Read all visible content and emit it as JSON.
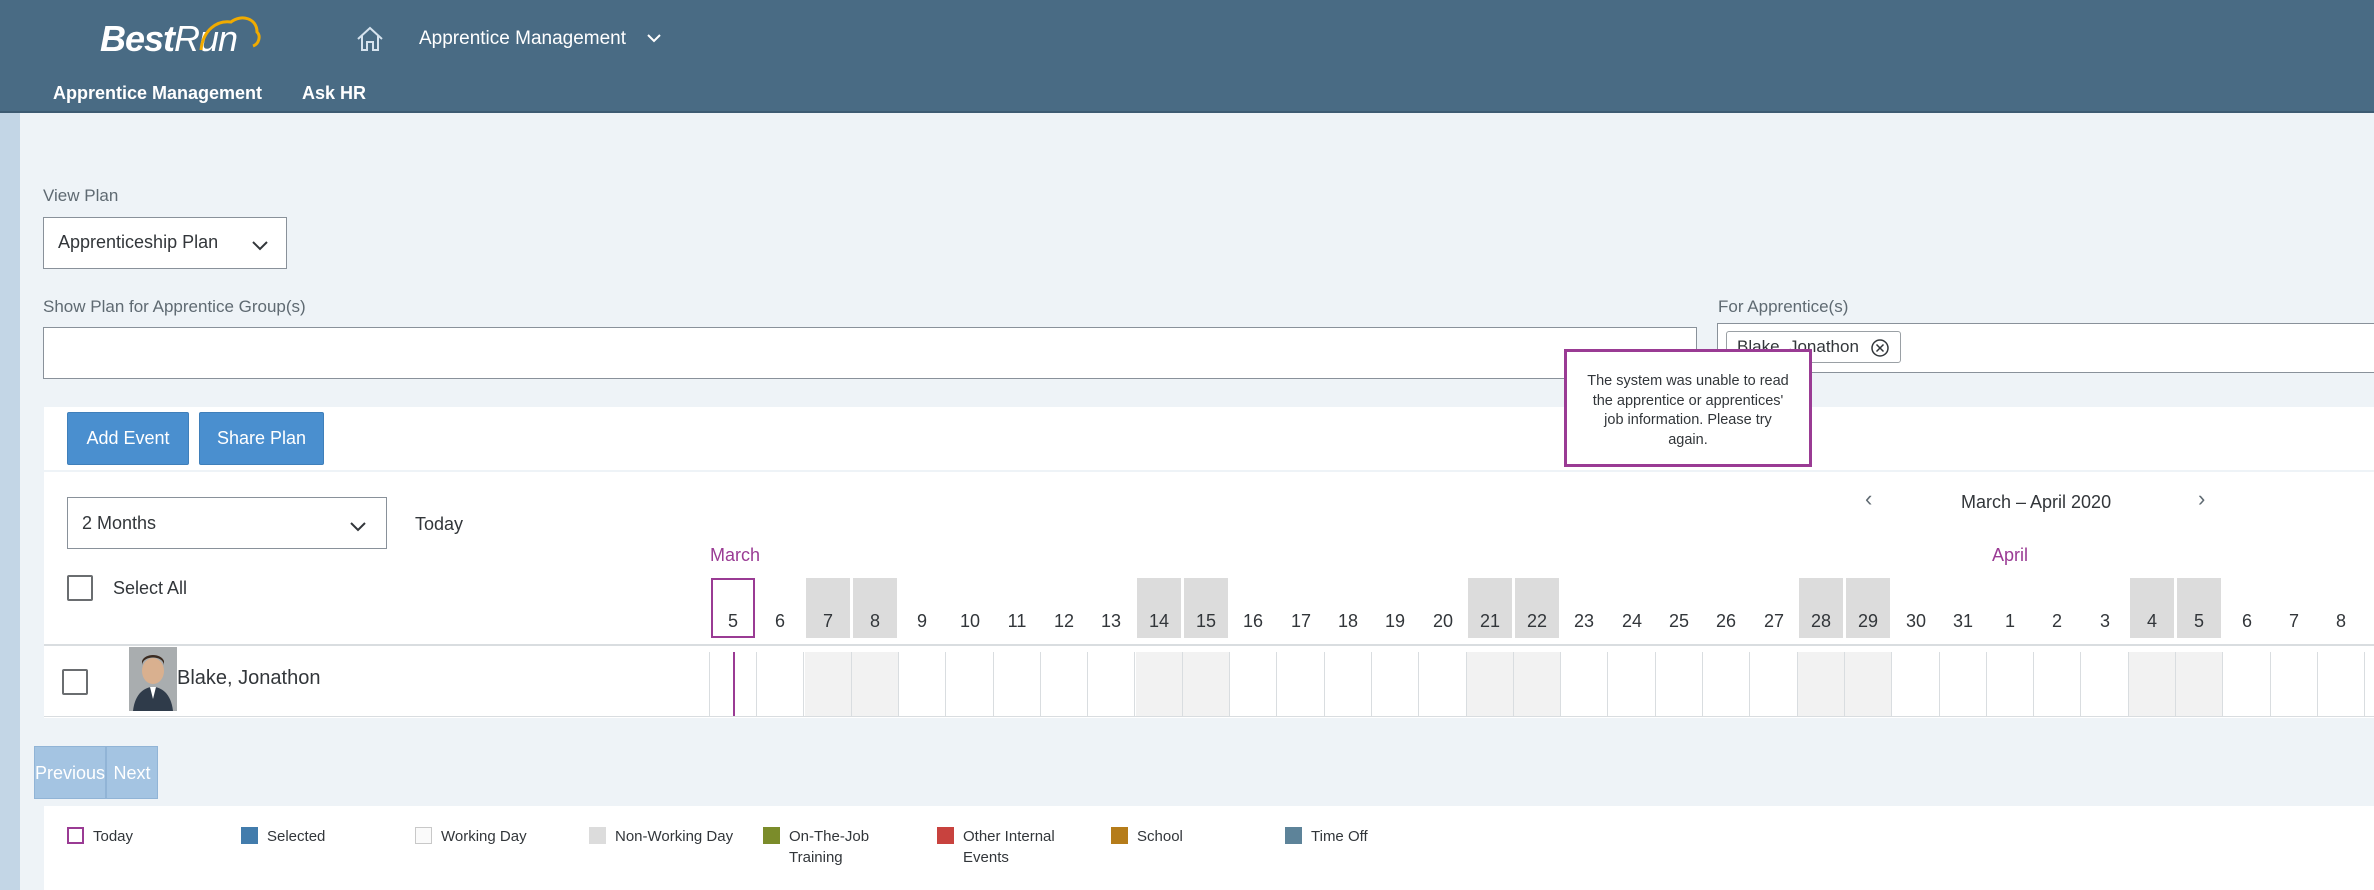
{
  "header": {
    "logo_bold": "Best",
    "logo_light": "Run",
    "app_title": "Apprentice Management",
    "nav": [
      "Apprentice Management",
      "Ask HR"
    ]
  },
  "filters": {
    "view_plan_label": "View Plan",
    "view_plan_value": "Apprenticeship Plan",
    "group_label": "Show Plan for Apprentice Group(s)",
    "group_value": "",
    "apprentice_label": "For Apprentice(s)",
    "apprentice_token": "Blake, Jonathon"
  },
  "toolbar": {
    "add_event": "Add Event",
    "share_plan": "Share Plan"
  },
  "calendar": {
    "range_select": "2 Months",
    "today_label": "Today",
    "range_text": "March – April 2020",
    "select_all": "Select All",
    "months": [
      "March",
      "April"
    ],
    "days": [
      {
        "d": "5",
        "w": false,
        "today": true
      },
      {
        "d": "6",
        "w": false
      },
      {
        "d": "7",
        "w": true
      },
      {
        "d": "8",
        "w": true
      },
      {
        "d": "9",
        "w": false
      },
      {
        "d": "10",
        "w": false
      },
      {
        "d": "11",
        "w": false
      },
      {
        "d": "12",
        "w": false
      },
      {
        "d": "13",
        "w": false
      },
      {
        "d": "14",
        "w": true
      },
      {
        "d": "15",
        "w": true
      },
      {
        "d": "16",
        "w": false
      },
      {
        "d": "17",
        "w": false
      },
      {
        "d": "18",
        "w": false
      },
      {
        "d": "19",
        "w": false
      },
      {
        "d": "20",
        "w": false
      },
      {
        "d": "21",
        "w": true
      },
      {
        "d": "22",
        "w": true
      },
      {
        "d": "23",
        "w": false
      },
      {
        "d": "24",
        "w": false
      },
      {
        "d": "25",
        "w": false
      },
      {
        "d": "26",
        "w": false
      },
      {
        "d": "27",
        "w": false
      },
      {
        "d": "28",
        "w": true
      },
      {
        "d": "29",
        "w": true
      },
      {
        "d": "30",
        "w": false
      },
      {
        "d": "31",
        "w": false
      },
      {
        "d": "1",
        "w": false
      },
      {
        "d": "2",
        "w": false
      },
      {
        "d": "3",
        "w": false
      },
      {
        "d": "4",
        "w": true
      },
      {
        "d": "5",
        "w": true
      },
      {
        "d": "6",
        "w": false
      },
      {
        "d": "7",
        "w": false
      },
      {
        "d": "8",
        "w": false
      }
    ],
    "row_name": "Blake, Jonathon"
  },
  "pager": {
    "previous": "Previous",
    "next": "Next"
  },
  "legend": [
    {
      "label": "Today",
      "color": "#9a3b94",
      "style": "outline"
    },
    {
      "label": "Selected",
      "color": "#427cac",
      "style": "fill"
    },
    {
      "label": "Working Day",
      "color": "#fafafa",
      "style": "fill"
    },
    {
      "label": "Non-Working Day",
      "color": "#dcdcdc",
      "style": "fill"
    },
    {
      "label": "On-The-Job Training",
      "color": "#7b8c2a",
      "style": "fill"
    },
    {
      "label": "Other Internal Events",
      "color": "#c8423e",
      "style": "fill"
    },
    {
      "label": "School",
      "color": "#b57c1a",
      "style": "fill"
    },
    {
      "label": "Time Off",
      "color": "#5d8399",
      "style": "fill"
    }
  ],
  "popover": {
    "message": "The system was unable to read the apprentice or apprentices' job information. Please try again."
  }
}
